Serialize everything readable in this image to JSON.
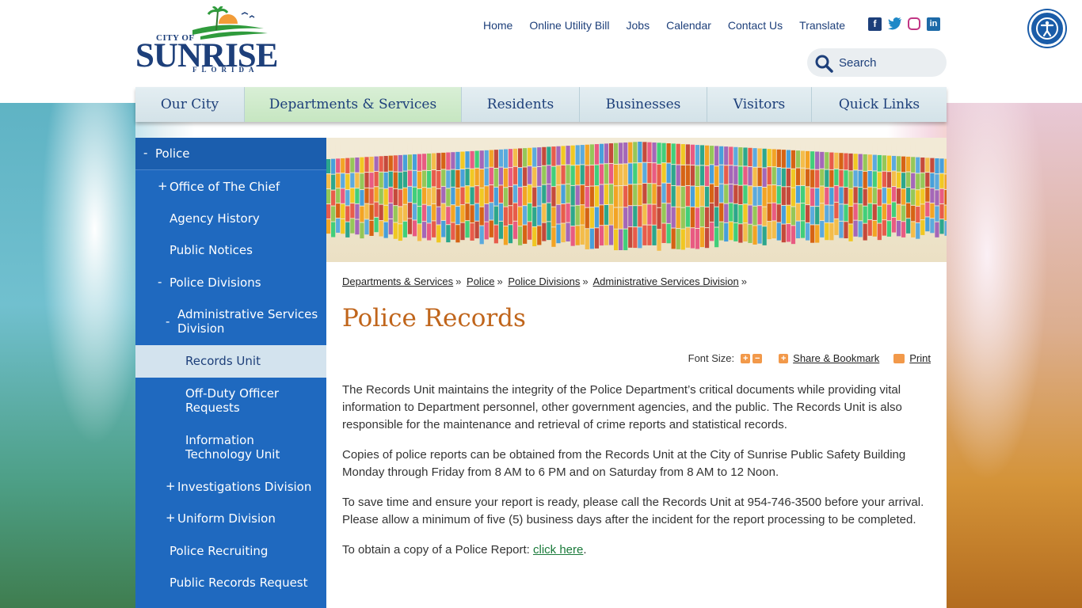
{
  "logo": {
    "city_of": "CITY OF",
    "name": "SUNRISE",
    "state": "FLORIDA"
  },
  "topnav": [
    "Home",
    "Online Utility Bill",
    "Jobs",
    "Calendar",
    "Contact Us",
    "Translate"
  ],
  "social": {
    "facebook": "f",
    "twitter": "🐦",
    "linkedin": "in"
  },
  "search": {
    "placeholder": "Search"
  },
  "mainnav": [
    "Our City",
    "Departments & Services",
    "Residents",
    "Businesses",
    "Visitors",
    "Quick Links"
  ],
  "sidebar": {
    "items": [
      {
        "sign": "-",
        "label": "Police"
      },
      {
        "sign": "+",
        "label": "Office of The Chief"
      },
      {
        "sign": "",
        "label": "Agency History"
      },
      {
        "sign": "",
        "label": "Public Notices"
      },
      {
        "sign": "-",
        "label": "Police Divisions"
      },
      {
        "sign": "-",
        "label": "Administrative Services Division"
      },
      {
        "sign": "",
        "label": "Records Unit"
      },
      {
        "sign": "",
        "label": "Off-Duty Officer Requests"
      },
      {
        "sign": "",
        "label": "Information Technology Unit"
      },
      {
        "sign": "+",
        "label": "Investigations Division"
      },
      {
        "sign": "+",
        "label": "Uniform Division"
      },
      {
        "sign": "",
        "label": "Police Recruiting"
      },
      {
        "sign": "",
        "label": "Public Records Request"
      }
    ]
  },
  "breadcrumb": [
    "Departments & Services",
    "Police",
    "Police Divisions",
    "Administrative Services Division"
  ],
  "breadcrumb_sep": "»",
  "page_title": "Police Records",
  "tools": {
    "font_size_label": "Font Size:",
    "plus": "+",
    "minus": "−",
    "share_label": "Share & Bookmark",
    "print_label": "Print"
  },
  "paragraphs": [
    "The Records Unit maintains the integrity of the Police Department’s critical documents while providing vital information to Department personnel, other government agencies, and the public. The Records Unit is also responsible for the maintenance and retrieval of crime reports and statistical records.",
    "Copies of police reports can be obtained from the Records Unit at the City of Sunrise Public Safety Building Monday through Friday from 8 AM to 6 PM and on Saturday from 8 AM to 12 Noon.",
    "To save time and ensure your report is ready, please call the Records Unit at 954-746-3500 before your arrival. Please allow a minimum of five (5) business days after the incident for the report processing to be completed."
  ],
  "report_line": {
    "text": "To obtain a copy of a Police Report: ",
    "link": "click here",
    "end": "."
  },
  "colors": {
    "brand_navy": "#1d3f7a",
    "sidebar_blue": "#1f69bf",
    "title_orange": "#c0651b",
    "active_nav_green": "#c6e6c1"
  }
}
